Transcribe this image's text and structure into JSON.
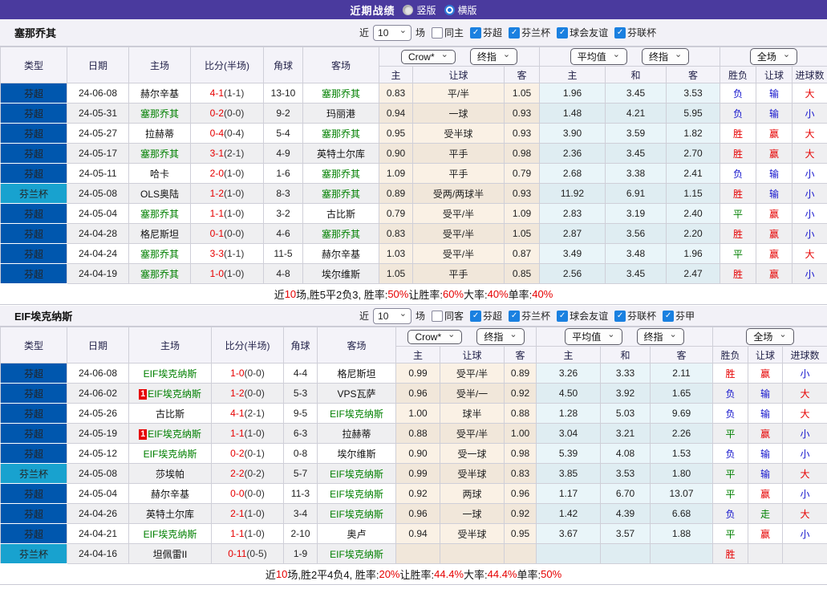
{
  "titlebar": {
    "title": "近期战绩",
    "radios": [
      {
        "label": "竖版",
        "selected": false
      },
      {
        "label": "横版",
        "selected": true
      }
    ]
  },
  "colors": {
    "topbar": "#4a3a9e",
    "league_super": "#0057ae",
    "league_cup": "#18a2cf",
    "team_green": "#008000",
    "score_red": "#e60000",
    "result_red": "#e60000",
    "result_blue": "#1414cc",
    "result_green": "#008000",
    "checkbox_blue": "#1a80e0"
  },
  "table_header": {
    "main_cols": [
      "类型",
      "日期",
      "主场",
      "比分(半场)",
      "角球",
      "客场"
    ],
    "group1": {
      "selects": [
        "Crow*",
        "终指"
      ],
      "cols": [
        "主",
        "让球",
        "客"
      ]
    },
    "group2": {
      "selects": [
        "平均值",
        "终指"
      ],
      "cols": [
        "主",
        "和",
        "客"
      ]
    },
    "group3": {
      "selects": [
        "全场"
      ],
      "cols": [
        "胜负",
        "让球",
        "进球数"
      ]
    }
  },
  "sections": [
    {
      "team": "塞那乔其",
      "filter": {
        "near_label": "近",
        "count": "10",
        "matches_label": "场",
        "same": {
          "label": "同主",
          "checked": false
        },
        "leagues": [
          {
            "label": "芬超",
            "checked": true
          },
          {
            "label": "芬兰杯",
            "checked": true
          },
          {
            "label": "球会友谊",
            "checked": true
          },
          {
            "label": "芬联杯",
            "checked": true
          }
        ]
      },
      "rows": [
        {
          "league": "芬超",
          "cup": false,
          "date": "24-06-08",
          "home": "赫尔辛基",
          "home_team": false,
          "home_red": "",
          "score": "4-1",
          "half": "(1-1)",
          "corner": "13-10",
          "away": "塞那乔其",
          "away_team": true,
          "away_red": "",
          "o1": [
            "0.83",
            "平/半",
            "1.05"
          ],
          "o2": [
            "1.96",
            "3.45",
            "3.53"
          ],
          "res": [
            "负:b",
            "输:b",
            "大:r"
          ]
        },
        {
          "league": "芬超",
          "cup": false,
          "date": "24-05-31",
          "home": "塞那乔其",
          "home_team": true,
          "home_red": "",
          "score": "0-2",
          "half": "(0-0)",
          "corner": "9-2",
          "away": "玛丽港",
          "away_team": false,
          "away_red": "",
          "o1": [
            "0.94",
            "一球",
            "0.93"
          ],
          "o2": [
            "1.48",
            "4.21",
            "5.95"
          ],
          "res": [
            "负:b",
            "输:b",
            "小:b"
          ]
        },
        {
          "league": "芬超",
          "cup": false,
          "date": "24-05-27",
          "home": "拉赫蒂",
          "home_team": false,
          "home_red": "",
          "score": "0-4",
          "half": "(0-4)",
          "corner": "5-4",
          "away": "塞那乔其",
          "away_team": true,
          "away_red": "",
          "o1": [
            "0.95",
            "受半球",
            "0.93"
          ],
          "o2": [
            "3.90",
            "3.59",
            "1.82"
          ],
          "res": [
            "胜:r",
            "赢:r",
            "大:r"
          ]
        },
        {
          "league": "芬超",
          "cup": false,
          "date": "24-05-17",
          "home": "塞那乔其",
          "home_team": true,
          "home_red": "",
          "score": "3-1",
          "half": "(2-1)",
          "corner": "4-9",
          "away": "英特土尔库",
          "away_team": false,
          "away_red": "",
          "o1": [
            "0.90",
            "平手",
            "0.98"
          ],
          "o2": [
            "2.36",
            "3.45",
            "2.70"
          ],
          "res": [
            "胜:r",
            "赢:r",
            "大:r"
          ]
        },
        {
          "league": "芬超",
          "cup": false,
          "date": "24-05-11",
          "home": "哈卡",
          "home_team": false,
          "home_red": "",
          "score": "2-0",
          "half": "(1-0)",
          "corner": "1-6",
          "away": "塞那乔其",
          "away_team": true,
          "away_red": "",
          "o1": [
            "1.09",
            "平手",
            "0.79"
          ],
          "o2": [
            "2.68",
            "3.38",
            "2.41"
          ],
          "res": [
            "负:b",
            "输:b",
            "小:b"
          ]
        },
        {
          "league": "芬兰杯",
          "cup": true,
          "date": "24-05-08",
          "home": "OLS奥陆",
          "home_team": false,
          "home_red": "",
          "score": "1-2",
          "half": "(1-0)",
          "corner": "8-3",
          "away": "塞那乔其",
          "away_team": true,
          "away_red": "",
          "o1": [
            "0.89",
            "受两/两球半",
            "0.93"
          ],
          "o2": [
            "11.92",
            "6.91",
            "1.15"
          ],
          "res": [
            "胜:r",
            "输:b",
            "小:b"
          ]
        },
        {
          "league": "芬超",
          "cup": false,
          "date": "24-05-04",
          "home": "塞那乔其",
          "home_team": true,
          "home_red": "",
          "score": "1-1",
          "half": "(1-0)",
          "corner": "3-2",
          "away": "古比斯",
          "away_team": false,
          "away_red": "",
          "o1": [
            "0.79",
            "受平/半",
            "1.09"
          ],
          "o2": [
            "2.83",
            "3.19",
            "2.40"
          ],
          "res": [
            "平:g",
            "赢:r",
            "小:b"
          ]
        },
        {
          "league": "芬超",
          "cup": false,
          "date": "24-04-28",
          "home": "格尼斯坦",
          "home_team": false,
          "home_red": "",
          "score": "0-1",
          "half": "(0-0)",
          "corner": "4-6",
          "away": "塞那乔其",
          "away_team": true,
          "away_red": "",
          "o1": [
            "0.83",
            "受平/半",
            "1.05"
          ],
          "o2": [
            "2.87",
            "3.56",
            "2.20"
          ],
          "res": [
            "胜:r",
            "赢:r",
            "小:b"
          ]
        },
        {
          "league": "芬超",
          "cup": false,
          "date": "24-04-24",
          "home": "塞那乔其",
          "home_team": true,
          "home_red": "",
          "score": "3-3",
          "half": "(1-1)",
          "corner": "11-5",
          "away": "赫尔辛基",
          "away_team": false,
          "away_red": "",
          "o1": [
            "1.03",
            "受平/半",
            "0.87"
          ],
          "o2": [
            "3.49",
            "3.48",
            "1.96"
          ],
          "res": [
            "平:g",
            "赢:r",
            "大:r"
          ]
        },
        {
          "league": "芬超",
          "cup": false,
          "date": "24-04-19",
          "home": "塞那乔其",
          "home_team": true,
          "home_red": "",
          "score": "1-0",
          "half": "(1-0)",
          "corner": "4-8",
          "away": "埃尔维斯",
          "away_team": false,
          "away_red": "",
          "o1": [
            "1.05",
            "平手",
            "0.85"
          ],
          "o2": [
            "2.56",
            "3.45",
            "2.47"
          ],
          "res": [
            "胜:r",
            "赢:r",
            "小:b"
          ]
        }
      ],
      "summary": [
        [
          "近",
          0
        ],
        [
          "10",
          1
        ],
        [
          "场,胜5平2负3, 胜率:",
          0
        ],
        [
          "50%",
          1
        ],
        [
          " 让胜率:",
          0
        ],
        [
          "60%",
          1
        ],
        [
          " 大率:",
          0
        ],
        [
          "40%",
          1
        ],
        [
          " 单率:",
          0
        ],
        [
          "40%",
          1
        ]
      ]
    },
    {
      "team": "EIF埃克纳斯",
      "filter": {
        "near_label": "近",
        "count": "10",
        "matches_label": "场",
        "same": {
          "label": "同客",
          "checked": false
        },
        "leagues": [
          {
            "label": "芬超",
            "checked": true
          },
          {
            "label": "芬兰杯",
            "checked": true
          },
          {
            "label": "球会友谊",
            "checked": true
          },
          {
            "label": "芬联杯",
            "checked": true
          },
          {
            "label": "芬甲",
            "checked": true
          }
        ]
      },
      "rows": [
        {
          "league": "芬超",
          "cup": false,
          "date": "24-06-08",
          "home": "EIF埃克纳斯",
          "home_team": true,
          "home_red": "",
          "score": "1-0",
          "half": "(0-0)",
          "corner": "4-4",
          "away": "格尼斯坦",
          "away_team": false,
          "away_red": "",
          "o1": [
            "0.99",
            "受平/半",
            "0.89"
          ],
          "o2": [
            "3.26",
            "3.33",
            "2.11"
          ],
          "res": [
            "胜:r",
            "赢:r",
            "小:b"
          ]
        },
        {
          "league": "芬超",
          "cup": false,
          "date": "24-06-02",
          "home": "EIF埃克纳斯",
          "home_team": true,
          "home_red": "1",
          "score": "1-2",
          "half": "(0-0)",
          "corner": "5-3",
          "away": "VPS瓦萨",
          "away_team": false,
          "away_red": "",
          "o1": [
            "0.96",
            "受半/一",
            "0.92"
          ],
          "o2": [
            "4.50",
            "3.92",
            "1.65"
          ],
          "res": [
            "负:b",
            "输:b",
            "大:r"
          ]
        },
        {
          "league": "芬超",
          "cup": false,
          "date": "24-05-26",
          "home": "古比斯",
          "home_team": false,
          "home_red": "",
          "score": "4-1",
          "half": "(2-1)",
          "corner": "9-5",
          "away": "EIF埃克纳斯",
          "away_team": true,
          "away_red": "",
          "o1": [
            "1.00",
            "球半",
            "0.88"
          ],
          "o2": [
            "1.28",
            "5.03",
            "9.69"
          ],
          "res": [
            "负:b",
            "输:b",
            "大:r"
          ]
        },
        {
          "league": "芬超",
          "cup": false,
          "date": "24-05-19",
          "home": "EIF埃克纳斯",
          "home_team": true,
          "home_red": "1",
          "score": "1-1",
          "half": "(1-0)",
          "corner": "6-3",
          "away": "拉赫蒂",
          "away_team": false,
          "away_red": "",
          "o1": [
            "0.88",
            "受平/半",
            "1.00"
          ],
          "o2": [
            "3.04",
            "3.21",
            "2.26"
          ],
          "res": [
            "平:g",
            "赢:r",
            "小:b"
          ]
        },
        {
          "league": "芬超",
          "cup": false,
          "date": "24-05-12",
          "home": "EIF埃克纳斯",
          "home_team": true,
          "home_red": "",
          "score": "0-2",
          "half": "(0-1)",
          "corner": "0-8",
          "away": "埃尔维斯",
          "away_team": false,
          "away_red": "",
          "o1": [
            "0.90",
            "受一球",
            "0.98"
          ],
          "o2": [
            "5.39",
            "4.08",
            "1.53"
          ],
          "res": [
            "负:b",
            "输:b",
            "小:b"
          ]
        },
        {
          "league": "芬兰杯",
          "cup": true,
          "date": "24-05-08",
          "home": "莎埃帕",
          "home_team": false,
          "home_red": "",
          "score": "2-2",
          "half": "(0-2)",
          "corner": "5-7",
          "away": "EIF埃克纳斯",
          "away_team": true,
          "away_red": "",
          "o1": [
            "0.99",
            "受半球",
            "0.83"
          ],
          "o2": [
            "3.85",
            "3.53",
            "1.80"
          ],
          "res": [
            "平:g",
            "输:b",
            "大:r"
          ]
        },
        {
          "league": "芬超",
          "cup": false,
          "date": "24-05-04",
          "home": "赫尔辛基",
          "home_team": false,
          "home_red": "",
          "score": "0-0",
          "half": "(0-0)",
          "corner": "11-3",
          "away": "EIF埃克纳斯",
          "away_team": true,
          "away_red": "",
          "o1": [
            "0.92",
            "两球",
            "0.96"
          ],
          "o2": [
            "1.17",
            "6.70",
            "13.07"
          ],
          "res": [
            "平:g",
            "赢:r",
            "小:b"
          ]
        },
        {
          "league": "芬超",
          "cup": false,
          "date": "24-04-26",
          "home": "英特土尔库",
          "home_team": false,
          "home_red": "",
          "score": "2-1",
          "half": "(1-0)",
          "corner": "3-4",
          "away": "EIF埃克纳斯",
          "away_team": true,
          "away_red": "",
          "o1": [
            "0.96",
            "一球",
            "0.92"
          ],
          "o2": [
            "1.42",
            "4.39",
            "6.68"
          ],
          "res": [
            "负:b",
            "走:g",
            "大:r"
          ]
        },
        {
          "league": "芬超",
          "cup": false,
          "date": "24-04-21",
          "home": "EIF埃克纳斯",
          "home_team": true,
          "home_red": "",
          "score": "1-1",
          "half": "(1-0)",
          "corner": "2-10",
          "away": "奥卢",
          "away_team": false,
          "away_red": "",
          "o1": [
            "0.94",
            "受半球",
            "0.95"
          ],
          "o2": [
            "3.67",
            "3.57",
            "1.88"
          ],
          "res": [
            "平:g",
            "赢:r",
            "小:b"
          ]
        },
        {
          "league": "芬兰杯",
          "cup": true,
          "date": "24-04-16",
          "home": "坦佩雷II",
          "home_team": false,
          "home_red": "",
          "score": "0-11",
          "half": "(0-5)",
          "corner": "1-9",
          "away": "EIF埃克纳斯",
          "away_team": true,
          "away_red": "",
          "o1": [
            "",
            "",
            ""
          ],
          "o2": [
            "",
            "",
            ""
          ],
          "res": [
            "胜:r",
            "",
            ""
          ]
        }
      ],
      "summary": [
        [
          "近",
          0
        ],
        [
          "10",
          1
        ],
        [
          "场,胜2平4负4, 胜率:",
          0
        ],
        [
          "20%",
          1
        ],
        [
          " 让胜率:",
          0
        ],
        [
          "44.4%",
          1
        ],
        [
          " 大率:",
          0
        ],
        [
          "44.4%",
          1
        ],
        [
          " 单率:",
          0
        ],
        [
          "50%",
          1
        ]
      ]
    }
  ]
}
